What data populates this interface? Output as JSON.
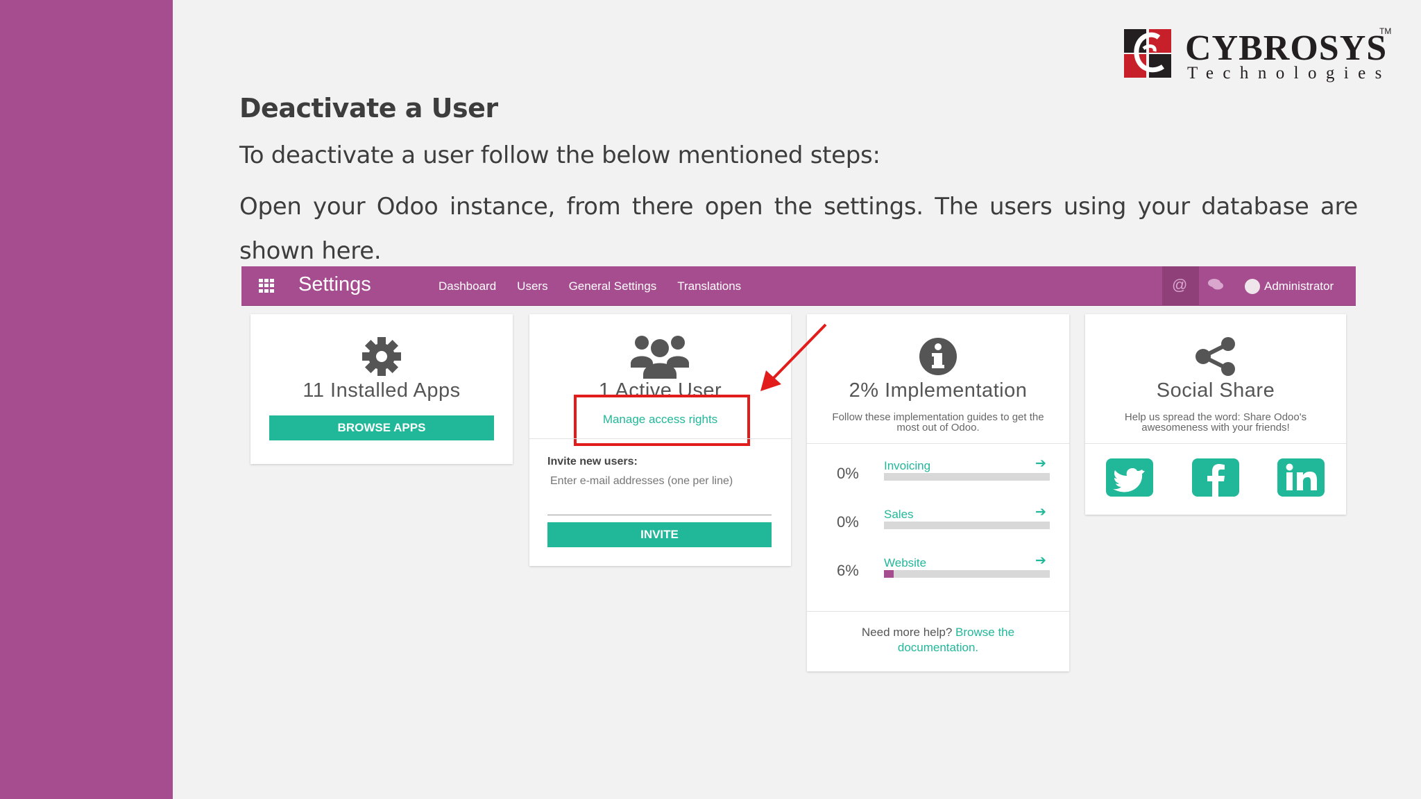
{
  "slide": {
    "title": "Deactivate a User",
    "paragraph1": "To deactivate a user follow the below mentioned steps:",
    "paragraph2": "Open your Odoo instance, from there open the settings. The users using your database are shown here."
  },
  "logo": {
    "name": "CYBROSYS",
    "tm": "TM",
    "sub": "Technologies"
  },
  "navbar": {
    "brand": "Settings",
    "menu": [
      "Dashboard",
      "Users",
      "General Settings",
      "Translations"
    ],
    "user": "Administrator",
    "color": "#a64d8f"
  },
  "installed_apps": {
    "title": "11 Installed Apps",
    "button": "BROWSE APPS"
  },
  "active_users": {
    "title": "1 Active User",
    "manage_link": "Manage access rights",
    "invite_label": "Invite new users:",
    "invite_placeholder": "Enter e-mail addresses (one per line)",
    "invite_button": "INVITE"
  },
  "implementation": {
    "title": "2% Implementation",
    "description": "Follow these implementation guides to get the most out of Odoo.",
    "items": [
      {
        "pct_label": "0%",
        "name": "Invoicing",
        "progress": 0
      },
      {
        "pct_label": "0%",
        "name": "Sales",
        "progress": 0
      },
      {
        "pct_label": "6%",
        "name": "Website",
        "progress": 6
      }
    ],
    "help_prefix": "Need more help?",
    "help_link": "Browse the documentation."
  },
  "social": {
    "title": "Social Share",
    "description": "Help us spread the word: Share Odoo's awesomeness with your friends!",
    "icons": [
      "twitter-icon",
      "facebook-icon",
      "linkedin-icon"
    ]
  },
  "colors": {
    "accent_teal": "#21b799",
    "purple": "#a64d8f",
    "annotation_red": "#e21b1b"
  }
}
